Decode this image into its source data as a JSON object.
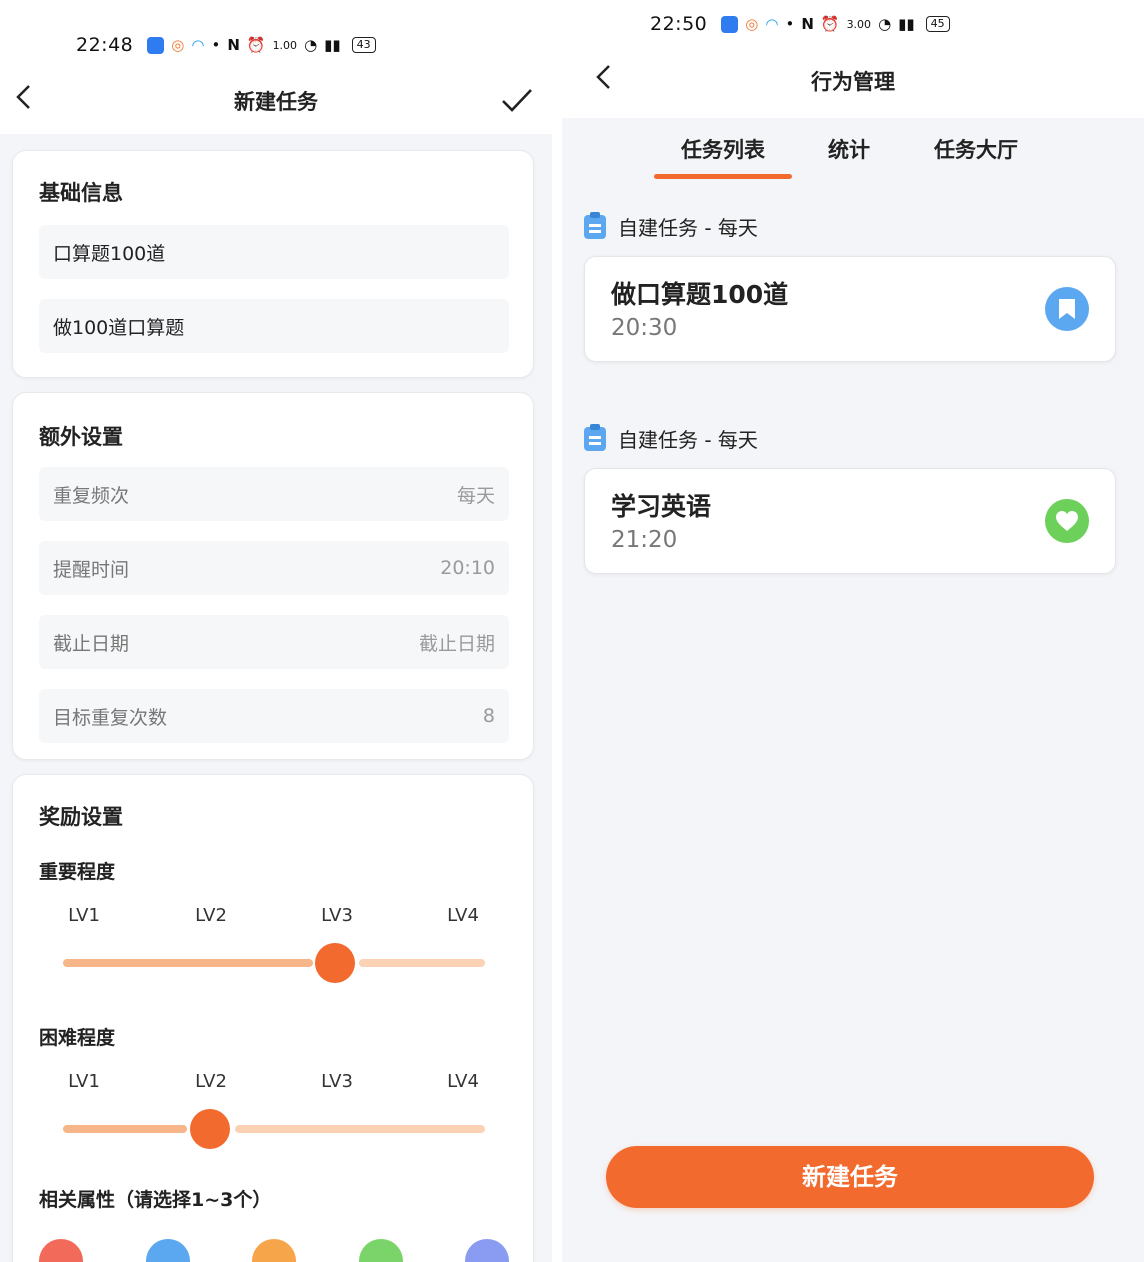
{
  "left": {
    "status_time": "22:48",
    "status_net": "1.00",
    "battery": "43",
    "title": "新建任务",
    "basic": {
      "title": "基础信息",
      "name_value": "口算题100道",
      "desc_value": "做100道口算题"
    },
    "extra": {
      "title": "额外设置",
      "rows": [
        {
          "label": "重复频次",
          "value": "每天"
        },
        {
          "label": "提醒时间",
          "value": "20:10"
        },
        {
          "label": "截止日期",
          "value": "截止日期"
        },
        {
          "label": "目标重复次数",
          "value": "8"
        }
      ]
    },
    "reward": {
      "title": "奖励设置",
      "importance": {
        "label": "重要程度",
        "levels": [
          "LV1",
          "LV2",
          "LV3",
          "LV4"
        ],
        "selected_index": 2
      },
      "difficulty": {
        "label": "困难程度",
        "levels": [
          "LV1",
          "LV2",
          "LV3",
          "LV4"
        ],
        "selected_index": 1
      },
      "attributes_label": "相关属性（请选择1~3个）",
      "attribute_icons": [
        {
          "name": "attr-red-icon",
          "color": "#f26a5a"
        },
        {
          "name": "attr-blue-icon",
          "color": "#5ba7f0"
        },
        {
          "name": "attr-orange-icon",
          "color": "#f7a54a"
        },
        {
          "name": "attr-green-icon",
          "color": "#7bd46a"
        },
        {
          "name": "attr-purple-icon",
          "color": "#8a9cf2"
        }
      ]
    }
  },
  "right": {
    "status_time": "22:50",
    "status_net": "3.00",
    "battery": "45",
    "title": "行为管理",
    "tabs": [
      "任务列表",
      "统计",
      "任务大厅"
    ],
    "active_tab": 0,
    "tasks": [
      {
        "section": "自建任务 - 每天",
        "name": "做口算题100道",
        "time": "20:30",
        "badge_color": "#5ba7f0",
        "badge_icon": "bookmark-icon"
      },
      {
        "section": "自建任务 - 每天",
        "name": "学习英语",
        "time": "21:20",
        "badge_color": "#6cd05a",
        "badge_icon": "heart-icon"
      }
    ],
    "cta_label": "新建任务"
  },
  "colors": {
    "accent": "#f26a2e",
    "track_light": "#fbd2b4",
    "track_fill": "#f7b68a"
  }
}
